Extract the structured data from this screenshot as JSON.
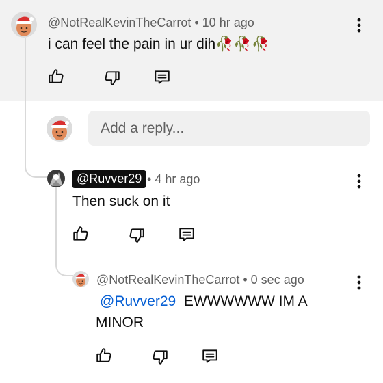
{
  "comment": {
    "author": "@NotRealKevinTheCarrot",
    "separator": " • ",
    "time": "10 hr ago",
    "text": "i can feel the pain in ur dih",
    "emoji": "🥀🥀🥀"
  },
  "reply_box": {
    "placeholder": "Add a reply..."
  },
  "reply1": {
    "author": "@Ruvver29",
    "separator": " • ",
    "time": "4 hr ago",
    "text": "Then suck on it"
  },
  "reply2": {
    "author": "@NotRealKevinTheCarrot",
    "separator": " • ",
    "time": "0 sec ago",
    "mention": "@Ruvver29",
    "text_line1": "EWWWWWW IM A",
    "text_line2": "MINOR"
  },
  "icons": {
    "like": "thumbs-up-icon",
    "dislike": "thumbs-down-icon",
    "reply": "reply-comment-icon",
    "menu": "more-vertical-icon"
  },
  "colors": {
    "accent_link": "#065fd4",
    "meta_text": "#606060",
    "highlight_band": "#f2f2f2"
  }
}
